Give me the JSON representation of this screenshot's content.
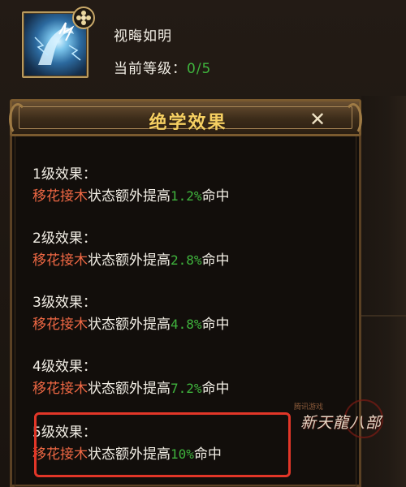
{
  "header": {
    "skill_name": "视晦如明",
    "level_label": "当前等级：",
    "level_value": "0/5"
  },
  "panel": {
    "title": "绝学效果",
    "close_symbol": "✕"
  },
  "effects": [
    {
      "title": "1级效果：",
      "skill": "移花接木",
      "text": "状态额外提高",
      "value": "1.2%",
      "suffix": "命中"
    },
    {
      "title": "2级效果：",
      "skill": "移花接木",
      "text": "状态额外提高",
      "value": "2.8%",
      "suffix": "命中"
    },
    {
      "title": "3级效果：",
      "skill": "移花接木",
      "text": "状态额外提高",
      "value": "4.8%",
      "suffix": "命中"
    },
    {
      "title": "4级效果：",
      "skill": "移花接木",
      "text": "状态额外提高",
      "value": "7.2%",
      "suffix": "命中"
    },
    {
      "title": "5级效果：",
      "skill": "移花接木",
      "text": "状态额外提高",
      "value": "10%",
      "suffix": "命中"
    }
  ],
  "watermark": {
    "line1": "腾讯游戏",
    "main": "新天龍八部"
  },
  "colors": {
    "skill_ref": "#ef6844",
    "percent": "#3fb33d",
    "title_gold": "#f5cf62",
    "highlight": "#e23628"
  },
  "icons": {
    "skill_icon": "lightning-arm-icon",
    "badge_icon": "flower-badge-icon",
    "close_icon": "close-icon"
  }
}
